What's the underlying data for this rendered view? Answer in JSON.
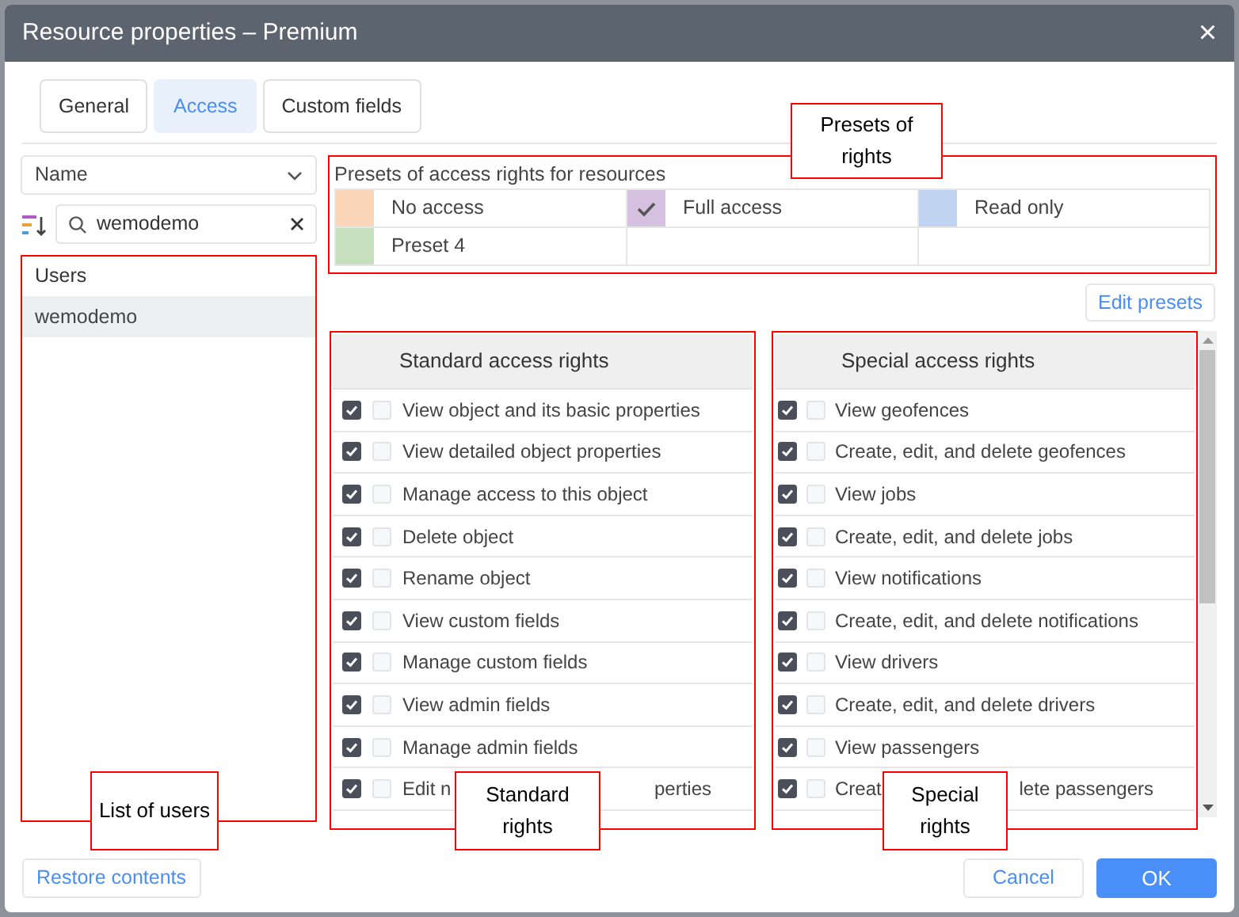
{
  "window": {
    "title": "Resource properties – Premium",
    "close": "×"
  },
  "tabs": [
    {
      "label": "General",
      "selected": false
    },
    {
      "label": "Access",
      "selected": true
    },
    {
      "label": "Custom fields",
      "selected": false
    }
  ],
  "sort": {
    "value": "Name"
  },
  "search": {
    "value": "wemodemo"
  },
  "users": {
    "heading": "Users",
    "items": [
      {
        "label": "wemodemo",
        "selected": true
      }
    ]
  },
  "presets": {
    "title": "Presets of access rights for resources",
    "items": [
      {
        "label": "No access",
        "color": "#fbd5b8",
        "selected": false
      },
      {
        "label": "Full access",
        "color": "#d5c0e0",
        "selected": true
      },
      {
        "label": "Read only",
        "color": "#c0d4f2",
        "selected": false
      },
      {
        "label": "Preset 4",
        "color": "#c6e0bd",
        "selected": false
      }
    ]
  },
  "edit_presets": "Edit presets",
  "standard": {
    "title": "Standard access rights",
    "rights": [
      {
        "label": "View object and its basic properties",
        "checked": true,
        "checked_2": false
      },
      {
        "label": "View detailed object properties",
        "checked": true,
        "checked_2": false
      },
      {
        "label": "Manage access to this object",
        "checked": true,
        "checked_2": false
      },
      {
        "label": "Delete object",
        "checked": true,
        "checked_2": false
      },
      {
        "label": "Rename object",
        "checked": true,
        "checked_2": false
      },
      {
        "label": "View custom fields",
        "checked": true,
        "checked_2": false
      },
      {
        "label": "Manage custom fields",
        "checked": true,
        "checked_2": false
      },
      {
        "label": "View admin fields",
        "checked": true,
        "checked_2": false
      },
      {
        "label": "Manage admin fields",
        "checked": true,
        "checked_2": false
      },
      {
        "label": "Edit n",
        "label_tail": "perties",
        "checked": true,
        "checked_2": false
      }
    ]
  },
  "special": {
    "title": "Special access rights",
    "rights": [
      {
        "label": "View geofences",
        "checked": true,
        "checked_2": false
      },
      {
        "label": "Create, edit, and delete geofences",
        "checked": true,
        "checked_2": false
      },
      {
        "label": "View jobs",
        "checked": true,
        "checked_2": false
      },
      {
        "label": "Create, edit, and delete jobs",
        "checked": true,
        "checked_2": false
      },
      {
        "label": "View notifications",
        "checked": true,
        "checked_2": false
      },
      {
        "label": "Create, edit, and delete notifications",
        "checked": true,
        "checked_2": false
      },
      {
        "label": "View drivers",
        "checked": true,
        "checked_2": false
      },
      {
        "label": "Create, edit, and delete drivers",
        "checked": true,
        "checked_2": false
      },
      {
        "label": "View passengers",
        "checked": true,
        "checked_2": false
      },
      {
        "label": "Creat",
        "label_tail": "lete passengers",
        "checked": true,
        "checked_2": false
      }
    ]
  },
  "footer": {
    "restore": "Restore contents",
    "cancel": "Cancel",
    "ok": "OK"
  },
  "callouts": [
    {
      "text": "Presets of rights"
    },
    {
      "text": "List of users"
    },
    {
      "text": "Standard rights"
    },
    {
      "text": "Special rights"
    }
  ]
}
